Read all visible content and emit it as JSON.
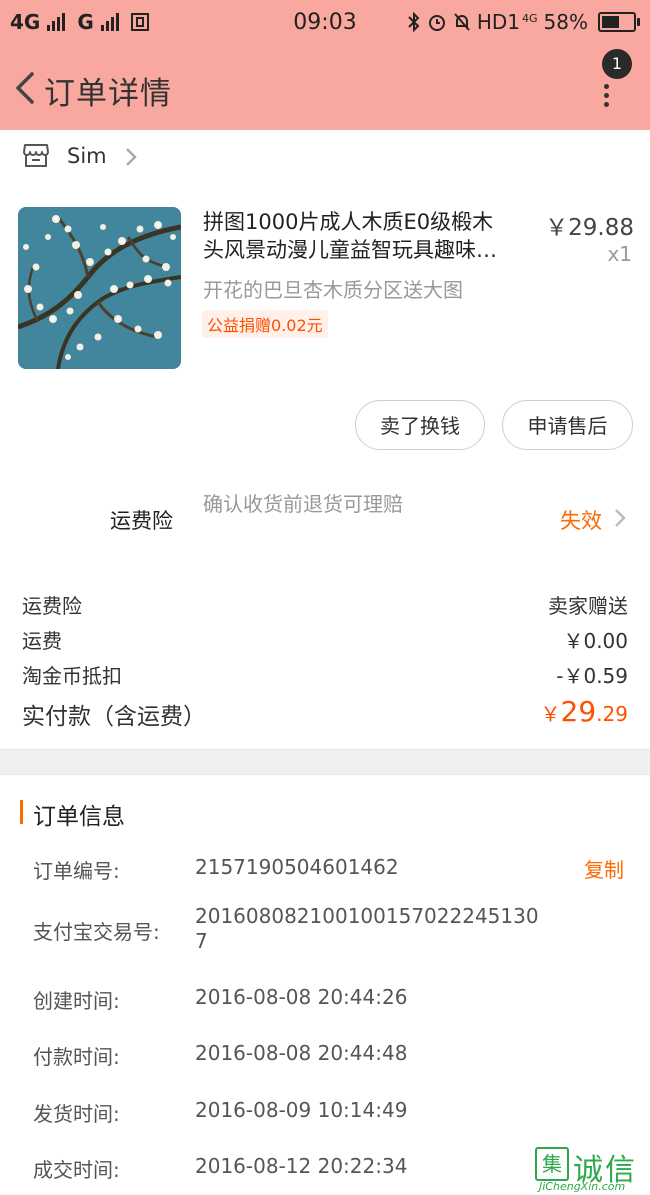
{
  "status_bar": {
    "network1": "4G",
    "network2": "G",
    "time": "09:03",
    "hd_label": "HD1",
    "net4g_small": "4G",
    "battery": "58%",
    "battery_level": 0.58
  },
  "header": {
    "title": "订单详情",
    "notification_count": "1"
  },
  "shop": {
    "name": "Sim"
  },
  "product": {
    "title_line1": "拼图1000片成人木质E0级椴木",
    "title_line2": "头风景动漫儿童益智玩具趣味…",
    "price": "￥29.88",
    "quantity": "x1",
    "sku": "开花的巴旦杏木质分区送大图",
    "charity": "公益捐赠0.02元"
  },
  "actions": {
    "sell_label": "卖了换钱",
    "after_sale_label": "申请售后"
  },
  "freight_insurance": {
    "label": "运费险",
    "description": "确认收货前退货可理赔",
    "status": "失效"
  },
  "fees": [
    {
      "label": "运费险",
      "value": "卖家赠送"
    },
    {
      "label": "运费",
      "value": "￥0.00"
    },
    {
      "label": "淘金币抵扣",
      "value": "-￥0.59"
    }
  ],
  "total": {
    "label": "实付款（含运费）",
    "currency": "￥",
    "integer": "29",
    "decimal": ".29"
  },
  "order_info": {
    "title": "订单信息",
    "copy_label": "复制",
    "rows": [
      {
        "label": "订单编号:",
        "value": "2157190504601462"
      },
      {
        "label": "支付宝交易号:",
        "value": "2016080821001001570222451307"
      },
      {
        "label": "创建时间:",
        "value": "2016-08-08 20:44:26"
      },
      {
        "label": "付款时间:",
        "value": "2016-08-08 20:44:48"
      },
      {
        "label": "发货时间:",
        "value": "2016-08-09 10:14:49"
      },
      {
        "label": "成交时间:",
        "value": "2016-08-12 20:22:34"
      }
    ]
  },
  "watermark": {
    "box_char": "集",
    "chars": "诚信",
    "url": "JiChengXin.com"
  },
  "colors": {
    "header_bg": "#f8a89e",
    "accent_orange": "#ff6a00",
    "price_red": "#ff5000",
    "watermark_green": "#2da84a"
  }
}
